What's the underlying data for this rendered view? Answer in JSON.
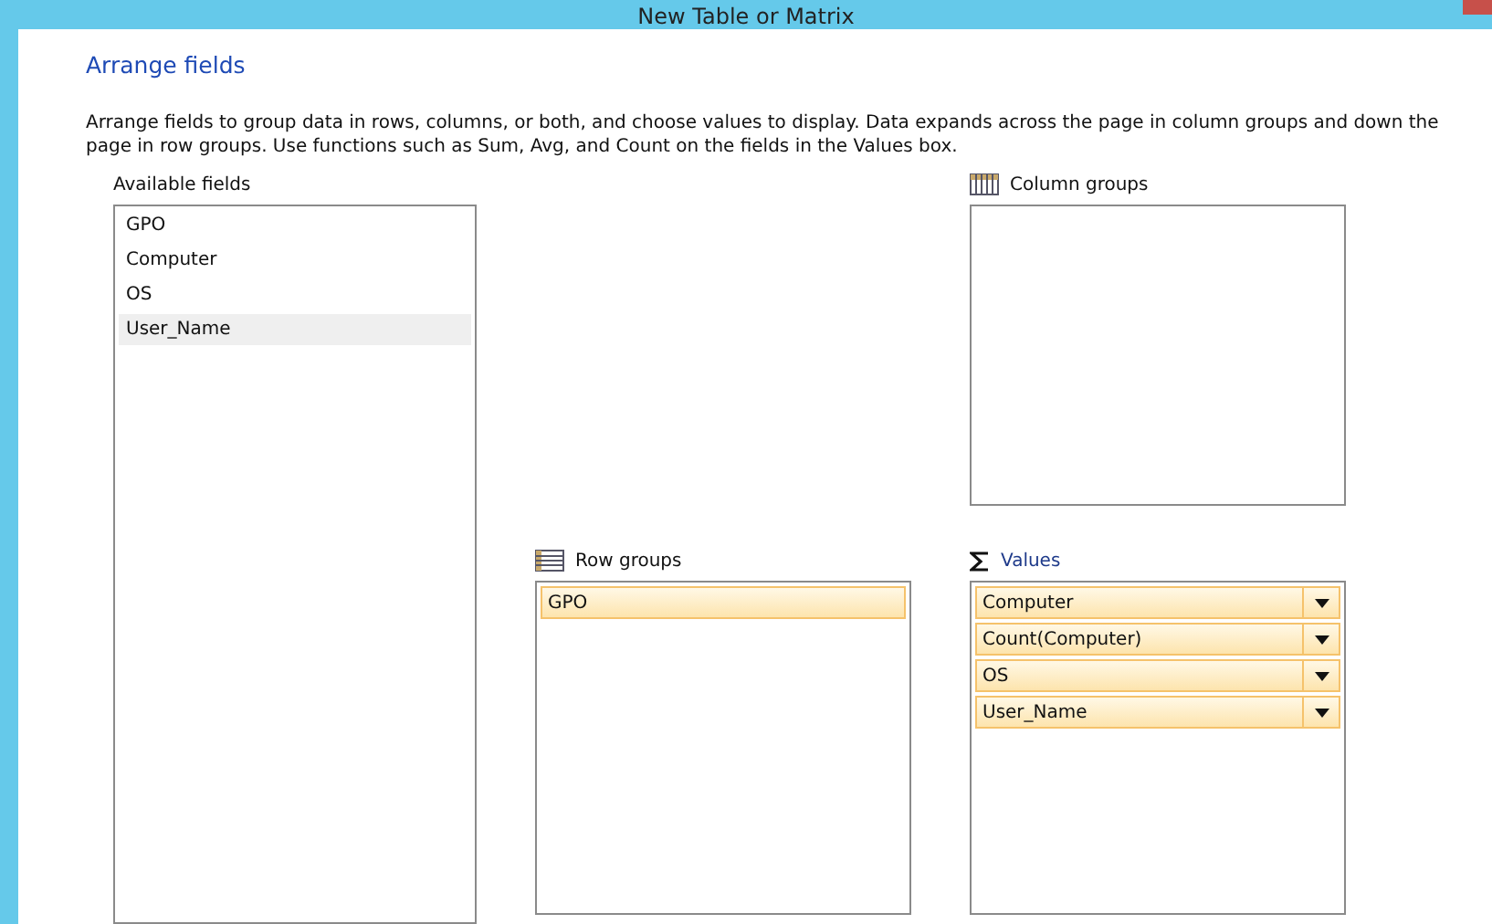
{
  "window": {
    "title": "New Table or Matrix"
  },
  "heading": "Arrange fields",
  "description": "Arrange fields to group data in rows, columns, or both, and choose values to display. Data expands across the page in column groups and down the page in row groups.  Use functions such as Sum, Avg, and Count on the fields in the Values box.",
  "available_fields": {
    "label": "Available fields",
    "items": [
      {
        "label": "GPO",
        "selected": false
      },
      {
        "label": "Computer",
        "selected": false
      },
      {
        "label": "OS",
        "selected": false
      },
      {
        "label": "User_Name",
        "selected": true
      }
    ]
  },
  "column_groups": {
    "label": "Column groups"
  },
  "row_groups": {
    "label": "Row groups",
    "items": [
      "GPO"
    ]
  },
  "values": {
    "label": "Values",
    "items": [
      "Computer",
      "Count(Computer)",
      "OS",
      "User_Name"
    ]
  }
}
